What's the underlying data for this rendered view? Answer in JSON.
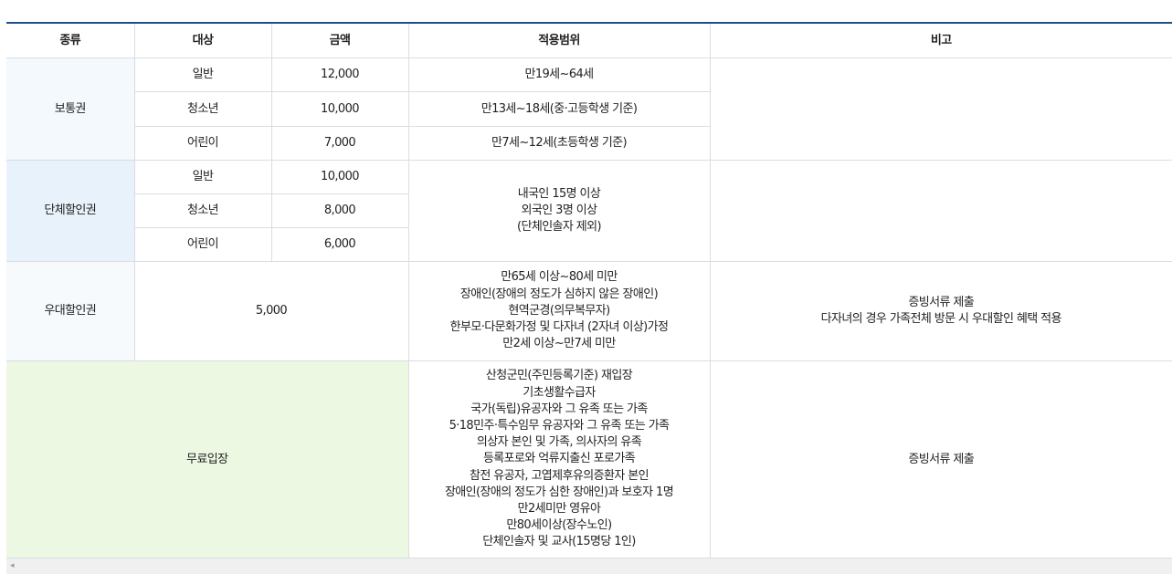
{
  "headers": [
    "종류",
    "대상",
    "금액",
    "적용범위",
    "비고"
  ],
  "regular": {
    "type": "보통권",
    "rows": [
      {
        "target": "일반",
        "price": "12,000",
        "scope": "만19세~64세"
      },
      {
        "target": "청소년",
        "price": "10,000",
        "scope": "만13세~18세(중·고등학생 기준)"
      },
      {
        "target": "어린이",
        "price": "7,000",
        "scope": "만7세~12세(초등학생 기준)"
      }
    ]
  },
  "group": {
    "type": "단체할인권",
    "rows": [
      {
        "target": "일반",
        "price": "10,000"
      },
      {
        "target": "청소년",
        "price": "8,000"
      },
      {
        "target": "어린이",
        "price": "6,000"
      }
    ],
    "scope_lines": [
      "내국인 15명 이상",
      "외국인 3명 이상",
      "(단체인솔자 제외)"
    ]
  },
  "preferential": {
    "type": "우대할인권",
    "price": "5,000",
    "scope_lines": [
      "만65세 이상~80세 미만",
      "장애인(장애의 정도가 심하지 않은 장애인)",
      "현역군경(의무복무자)",
      "한부모·다문화가정 및 다자녀 (2자녀 이상)가정",
      "만2세 이상~만7세 미만"
    ],
    "note_lines": [
      "증빙서류 제출",
      "다자녀의 경우 가족전체 방문 시 우대할인 혜택 적용"
    ]
  },
  "free": {
    "type": "무료입장",
    "scope_lines": [
      "산청군민(주민등록기준) 재입장",
      "기초생활수급자",
      "국가(독립)유공자와 그 유족 또는 가족",
      "5·18민주·특수임무 유공자와 그 유족 또는 가족",
      "의상자 본인 및 가족, 의사자의 유족",
      "등록포로와 억류지출신 포로가족",
      "참전 유공자, 고엽제후유의증환자 본인",
      "장애인(장애의 정도가 심한 장애인)과 보호자 1명",
      "만2세미만 영유아",
      "만80세이상(장수노인)",
      "단체인솔자 및 교사(15명당 1인)"
    ],
    "note": "증빙서류 제출"
  },
  "scrollbar": {
    "arrow": "◂"
  }
}
